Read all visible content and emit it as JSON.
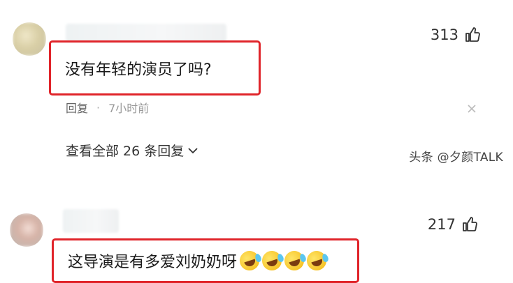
{
  "comments": [
    {
      "likes": "313",
      "text": "没有年轻的演员了吗?",
      "reply_label": "回复",
      "separator": "·",
      "time": "7小时前",
      "view_replies": "查看全部 26 条回复"
    },
    {
      "likes": "217",
      "text": "这导演是有多爱刘奶奶呀"
    }
  ],
  "watermark": "头条 @夕颜TALK",
  "colors": {
    "highlight_box": "#e0242a",
    "text": "#1a1a1a",
    "meta": "#666666"
  }
}
